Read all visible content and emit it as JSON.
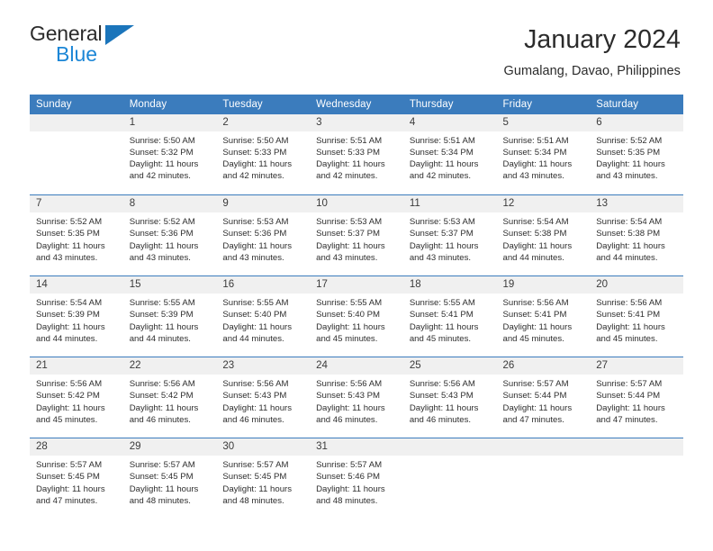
{
  "brand": {
    "name_top": "General",
    "name_bottom": "Blue",
    "accent_color": "#1b75bb",
    "accent_color_light": "#1b86d6"
  },
  "header": {
    "title": "January 2024",
    "subtitle": "Gumalang, Davao, Philippines"
  },
  "theme": {
    "header_bg": "#3b7cbd",
    "header_text": "#ffffff",
    "daynum_bg": "#f0f0f0",
    "cell_bg": "#ffffff",
    "text": "#2e2e2e"
  },
  "calendar": {
    "weekday_headers": [
      "Sunday",
      "Monday",
      "Tuesday",
      "Wednesday",
      "Thursday",
      "Friday",
      "Saturday"
    ],
    "labels": {
      "sunrise": "Sunrise:",
      "sunset": "Sunset:",
      "daylight": "Daylight:"
    },
    "weeks": [
      [
        {
          "day": "",
          "blank": true
        },
        {
          "day": "1",
          "sunrise": "Sunrise: 5:50 AM",
          "sunset": "Sunset: 5:32 PM",
          "daylight_1": "Daylight: 11 hours",
          "daylight_2": "and 42 minutes."
        },
        {
          "day": "2",
          "sunrise": "Sunrise: 5:50 AM",
          "sunset": "Sunset: 5:33 PM",
          "daylight_1": "Daylight: 11 hours",
          "daylight_2": "and 42 minutes."
        },
        {
          "day": "3",
          "sunrise": "Sunrise: 5:51 AM",
          "sunset": "Sunset: 5:33 PM",
          "daylight_1": "Daylight: 11 hours",
          "daylight_2": "and 42 minutes."
        },
        {
          "day": "4",
          "sunrise": "Sunrise: 5:51 AM",
          "sunset": "Sunset: 5:34 PM",
          "daylight_1": "Daylight: 11 hours",
          "daylight_2": "and 42 minutes."
        },
        {
          "day": "5",
          "sunrise": "Sunrise: 5:51 AM",
          "sunset": "Sunset: 5:34 PM",
          "daylight_1": "Daylight: 11 hours",
          "daylight_2": "and 43 minutes."
        },
        {
          "day": "6",
          "sunrise": "Sunrise: 5:52 AM",
          "sunset": "Sunset: 5:35 PM",
          "daylight_1": "Daylight: 11 hours",
          "daylight_2": "and 43 minutes."
        }
      ],
      [
        {
          "day": "7",
          "sunrise": "Sunrise: 5:52 AM",
          "sunset": "Sunset: 5:35 PM",
          "daylight_1": "Daylight: 11 hours",
          "daylight_2": "and 43 minutes."
        },
        {
          "day": "8",
          "sunrise": "Sunrise: 5:52 AM",
          "sunset": "Sunset: 5:36 PM",
          "daylight_1": "Daylight: 11 hours",
          "daylight_2": "and 43 minutes."
        },
        {
          "day": "9",
          "sunrise": "Sunrise: 5:53 AM",
          "sunset": "Sunset: 5:36 PM",
          "daylight_1": "Daylight: 11 hours",
          "daylight_2": "and 43 minutes."
        },
        {
          "day": "10",
          "sunrise": "Sunrise: 5:53 AM",
          "sunset": "Sunset: 5:37 PM",
          "daylight_1": "Daylight: 11 hours",
          "daylight_2": "and 43 minutes."
        },
        {
          "day": "11",
          "sunrise": "Sunrise: 5:53 AM",
          "sunset": "Sunset: 5:37 PM",
          "daylight_1": "Daylight: 11 hours",
          "daylight_2": "and 43 minutes."
        },
        {
          "day": "12",
          "sunrise": "Sunrise: 5:54 AM",
          "sunset": "Sunset: 5:38 PM",
          "daylight_1": "Daylight: 11 hours",
          "daylight_2": "and 44 minutes."
        },
        {
          "day": "13",
          "sunrise": "Sunrise: 5:54 AM",
          "sunset": "Sunset: 5:38 PM",
          "daylight_1": "Daylight: 11 hours",
          "daylight_2": "and 44 minutes."
        }
      ],
      [
        {
          "day": "14",
          "sunrise": "Sunrise: 5:54 AM",
          "sunset": "Sunset: 5:39 PM",
          "daylight_1": "Daylight: 11 hours",
          "daylight_2": "and 44 minutes."
        },
        {
          "day": "15",
          "sunrise": "Sunrise: 5:55 AM",
          "sunset": "Sunset: 5:39 PM",
          "daylight_1": "Daylight: 11 hours",
          "daylight_2": "and 44 minutes."
        },
        {
          "day": "16",
          "sunrise": "Sunrise: 5:55 AM",
          "sunset": "Sunset: 5:40 PM",
          "daylight_1": "Daylight: 11 hours",
          "daylight_2": "and 44 minutes."
        },
        {
          "day": "17",
          "sunrise": "Sunrise: 5:55 AM",
          "sunset": "Sunset: 5:40 PM",
          "daylight_1": "Daylight: 11 hours",
          "daylight_2": "and 45 minutes."
        },
        {
          "day": "18",
          "sunrise": "Sunrise: 5:55 AM",
          "sunset": "Sunset: 5:41 PM",
          "daylight_1": "Daylight: 11 hours",
          "daylight_2": "and 45 minutes."
        },
        {
          "day": "19",
          "sunrise": "Sunrise: 5:56 AM",
          "sunset": "Sunset: 5:41 PM",
          "daylight_1": "Daylight: 11 hours",
          "daylight_2": "and 45 minutes."
        },
        {
          "day": "20",
          "sunrise": "Sunrise: 5:56 AM",
          "sunset": "Sunset: 5:41 PM",
          "daylight_1": "Daylight: 11 hours",
          "daylight_2": "and 45 minutes."
        }
      ],
      [
        {
          "day": "21",
          "sunrise": "Sunrise: 5:56 AM",
          "sunset": "Sunset: 5:42 PM",
          "daylight_1": "Daylight: 11 hours",
          "daylight_2": "and 45 minutes."
        },
        {
          "day": "22",
          "sunrise": "Sunrise: 5:56 AM",
          "sunset": "Sunset: 5:42 PM",
          "daylight_1": "Daylight: 11 hours",
          "daylight_2": "and 46 minutes."
        },
        {
          "day": "23",
          "sunrise": "Sunrise: 5:56 AM",
          "sunset": "Sunset: 5:43 PM",
          "daylight_1": "Daylight: 11 hours",
          "daylight_2": "and 46 minutes."
        },
        {
          "day": "24",
          "sunrise": "Sunrise: 5:56 AM",
          "sunset": "Sunset: 5:43 PM",
          "daylight_1": "Daylight: 11 hours",
          "daylight_2": "and 46 minutes."
        },
        {
          "day": "25",
          "sunrise": "Sunrise: 5:56 AM",
          "sunset": "Sunset: 5:43 PM",
          "daylight_1": "Daylight: 11 hours",
          "daylight_2": "and 46 minutes."
        },
        {
          "day": "26",
          "sunrise": "Sunrise: 5:57 AM",
          "sunset": "Sunset: 5:44 PM",
          "daylight_1": "Daylight: 11 hours",
          "daylight_2": "and 47 minutes."
        },
        {
          "day": "27",
          "sunrise": "Sunrise: 5:57 AM",
          "sunset": "Sunset: 5:44 PM",
          "daylight_1": "Daylight: 11 hours",
          "daylight_2": "and 47 minutes."
        }
      ],
      [
        {
          "day": "28",
          "sunrise": "Sunrise: 5:57 AM",
          "sunset": "Sunset: 5:45 PM",
          "daylight_1": "Daylight: 11 hours",
          "daylight_2": "and 47 minutes."
        },
        {
          "day": "29",
          "sunrise": "Sunrise: 5:57 AM",
          "sunset": "Sunset: 5:45 PM",
          "daylight_1": "Daylight: 11 hours",
          "daylight_2": "and 48 minutes."
        },
        {
          "day": "30",
          "sunrise": "Sunrise: 5:57 AM",
          "sunset": "Sunset: 5:45 PM",
          "daylight_1": "Daylight: 11 hours",
          "daylight_2": "and 48 minutes."
        },
        {
          "day": "31",
          "sunrise": "Sunrise: 5:57 AM",
          "sunset": "Sunset: 5:46 PM",
          "daylight_1": "Daylight: 11 hours",
          "daylight_2": "and 48 minutes."
        },
        {
          "day": "",
          "blank": true
        },
        {
          "day": "",
          "blank": true
        },
        {
          "day": "",
          "blank": true
        }
      ]
    ]
  }
}
